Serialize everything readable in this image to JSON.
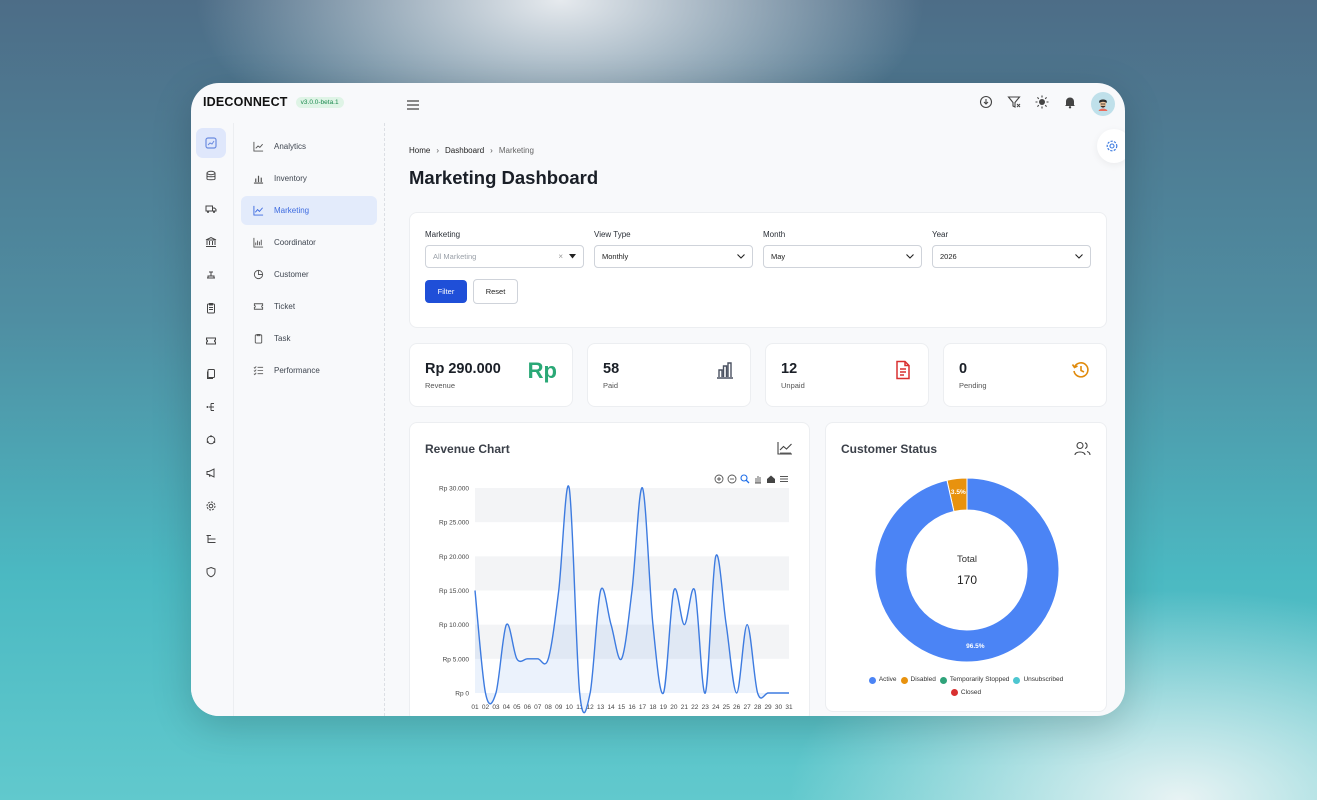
{
  "app": {
    "brand": "IDECONNECT",
    "version": "v3.0.0-beta.1"
  },
  "rail": {
    "icons": [
      "chart-icon",
      "database-icon",
      "truck-icon",
      "bank-icon",
      "scale-icon",
      "clipboard-icon",
      "ticket-icon",
      "copy-icon",
      "network-icon",
      "cycle-icon",
      "megaphone-icon",
      "settings-icon",
      "list-icon",
      "shield-icon"
    ]
  },
  "submenu": {
    "items": [
      {
        "label": "Analytics",
        "icon": "line-chart-icon"
      },
      {
        "label": "Inventory",
        "icon": "bar-chart-icon"
      },
      {
        "label": "Marketing",
        "icon": "trend-icon",
        "active": true
      },
      {
        "label": "Coordinator",
        "icon": "grid-chart-icon"
      },
      {
        "label": "Customer",
        "icon": "pie-icon"
      },
      {
        "label": "Ticket",
        "icon": "ticket-icon"
      },
      {
        "label": "Task",
        "icon": "clipboard-icon"
      },
      {
        "label": "Performance",
        "icon": "checklist-icon"
      }
    ]
  },
  "breadcrumb": {
    "home": "Home",
    "dashboard": "Dashboard",
    "current": "Marketing"
  },
  "page": {
    "title": "Marketing Dashboard"
  },
  "filters": {
    "marketing": {
      "label": "Marketing",
      "placeholder": "All Marketing"
    },
    "view_type": {
      "label": "View Type",
      "value": "Monthly"
    },
    "month": {
      "label": "Month",
      "value": "May"
    },
    "year": {
      "label": "Year",
      "value": "2026"
    },
    "filter_button": "Filter",
    "reset_button": "Reset"
  },
  "stats": [
    {
      "value": "Rp 290.000",
      "label": "Revenue",
      "icon": "rp-icon",
      "color": "#2aa876"
    },
    {
      "value": "58",
      "label": "Paid",
      "icon": "bar-chart-icon",
      "color": "#4a5160"
    },
    {
      "value": "12",
      "label": "Unpaid",
      "icon": "document-icon",
      "color": "#d93030"
    },
    {
      "value": "0",
      "label": "Pending",
      "icon": "history-icon",
      "color": "#e08a0b"
    }
  ],
  "revenue_chart": {
    "title": "Revenue Chart"
  },
  "customer_status": {
    "title": "Customer Status",
    "center_label": "Total",
    "center_value": "170"
  },
  "chart_data": [
    {
      "type": "area",
      "title": "Revenue Chart",
      "x": [
        "01",
        "02",
        "03",
        "04",
        "05",
        "06",
        "07",
        "08",
        "09",
        "10",
        "11",
        "12",
        "13",
        "14",
        "15",
        "16",
        "17",
        "18",
        "19",
        "20",
        "21",
        "22",
        "23",
        "24",
        "25",
        "26",
        "27",
        "28",
        "29",
        "30",
        "31"
      ],
      "series": [
        {
          "values": [
            15000,
            0,
            0,
            10000,
            5000,
            5000,
            5000,
            5000,
            15000,
            30000,
            0,
            0,
            15000,
            10000,
            5000,
            15000,
            30000,
            10000,
            0,
            15000,
            10000,
            15000,
            0,
            20000,
            10000,
            0,
            10000,
            0,
            0,
            0,
            0
          ],
          "color": "#3d7be0"
        }
      ],
      "yticks": [
        "Rp 30.000",
        "Rp 25.000",
        "Rp 20.000",
        "Rp 15.000",
        "Rp 10.000",
        "Rp 5.000",
        "Rp 0"
      ],
      "ylim": [
        0,
        30000
      ]
    },
    {
      "type": "pie",
      "title": "Customer Status",
      "categories": [
        "Active",
        "Disabled",
        "Temporarily Stopped",
        "Unsubscribed",
        "Closed"
      ],
      "values": [
        96.5,
        3.5,
        0,
        0,
        0
      ],
      "labels": [
        "96.5%",
        "3.5%",
        "",
        "",
        ""
      ],
      "colors": [
        "#4b84f5",
        "#e8920e",
        "#2fa37a",
        "#4dc6d0",
        "#d83030"
      ]
    }
  ]
}
